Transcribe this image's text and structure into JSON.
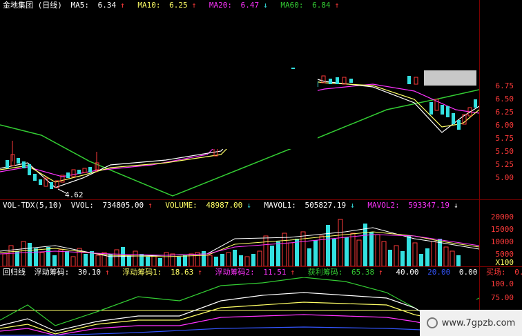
{
  "colors": {
    "background": "#000000",
    "up": "#ff3a3a",
    "down": "#33e0e0",
    "white": "#ffffff",
    "yellow": "#ffff66",
    "magenta": "#ff33ff",
    "green": "#33cc33",
    "blue": "#3355ff"
  },
  "main_panel": {
    "title": "金地集团 (日线)",
    "ma5": {
      "label": "MA5:",
      "value": "6.34",
      "arrow": "↑"
    },
    "ma10": {
      "label": "MA10:",
      "value": "6.25",
      "arrow": "↑"
    },
    "ma20": {
      "label": "MA20:",
      "value": "6.47",
      "arrow": "↓"
    },
    "ma60": {
      "label": "MA60:",
      "value": "6.84",
      "arrow": "↑"
    },
    "low_marker": "4.62",
    "price_axis": [
      "6.75",
      "6.50",
      "6.25",
      "6.00",
      "5.75",
      "5.50",
      "5.25",
      "5.00"
    ]
  },
  "volume_panel": {
    "title": "VOL-TDX(5,10)",
    "vvol": {
      "label": "VVOL:",
      "value": "734805.00",
      "arrow": "↑"
    },
    "volume": {
      "label": "VOLUME:",
      "value": "48987.00",
      "arrow": "↓"
    },
    "mavol1": {
      "label": "MAVOL1:",
      "value": "505827.19",
      "arrow": "↓"
    },
    "mavol2": {
      "label": "MAVOL2:",
      "value": "593347.19",
      "arrow": "↓"
    },
    "axis": [
      "20000",
      "15000",
      "10000",
      "5000",
      "X100"
    ]
  },
  "indicator_panel": {
    "title": "回归线",
    "f1": {
      "label": "浮动筹码:",
      "value": "30.10",
      "arrow": "↑"
    },
    "f2": {
      "label": "浮动筹码1:",
      "value": "18.63",
      "arrow": "↑"
    },
    "f3": {
      "label": "浮动筹码2:",
      "value": "11.51",
      "arrow": "↑"
    },
    "f4": {
      "label": "获利筹码:",
      "value": "65.38",
      "arrow": "↑"
    },
    "f5": {
      "value": "40.00"
    },
    "f6": {
      "value": "20.00"
    },
    "f7": {
      "value": "0.00"
    },
    "f8": {
      "label": "买场:",
      "value": "0.00"
    },
    "axis": [
      "100.0",
      "75.00"
    ]
  },
  "watermark": "www.7gpzb.com"
}
